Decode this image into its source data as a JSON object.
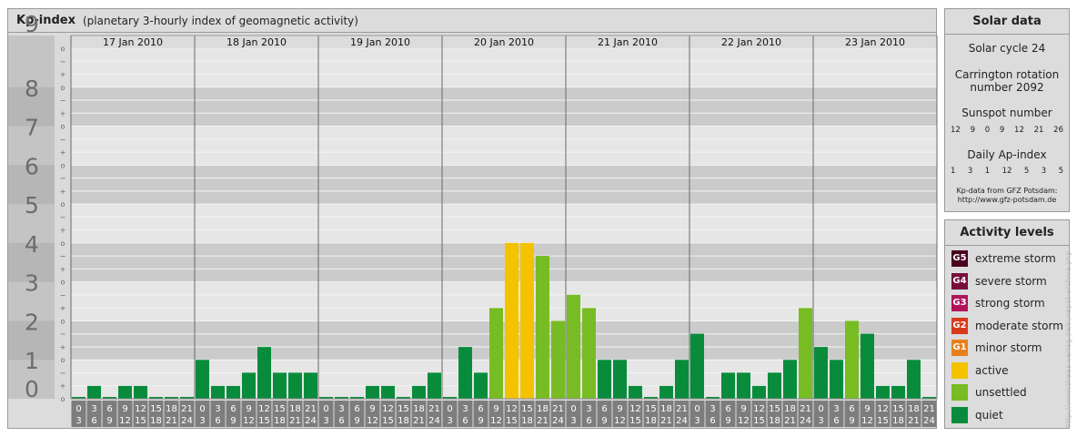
{
  "header": {
    "title": "Kp-index",
    "subtitle": "(planetary 3-hourly index of geomagnetic activity)"
  },
  "chart_data": {
    "type": "bar",
    "title": "Kp-index",
    "subtitle": "(planetary 3-hourly index of geomagnetic activity)",
    "ylim": [
      0,
      9
    ],
    "y_major_ticks": [
      "0",
      "1",
      "2",
      "3",
      "4",
      "5",
      "6",
      "7",
      "8",
      "9"
    ],
    "y_minor_ticks": [
      "o",
      "+",
      "−"
    ],
    "days": [
      "17 Jan 2010",
      "18 Jan 2010",
      "19 Jan 2010",
      "20 Jan 2010",
      "21 Jan 2010",
      "22 Jan 2010",
      "23 Jan 2010"
    ],
    "interval_start": [
      "0",
      "3",
      "6",
      "9",
      "12",
      "15",
      "18",
      "21"
    ],
    "interval_end": [
      "3",
      "6",
      "9",
      "12",
      "15",
      "18",
      "21",
      "24"
    ],
    "values": [
      [
        0,
        0.33,
        0,
        0.33,
        0.33,
        0,
        0,
        0
      ],
      [
        1.0,
        0.33,
        0.33,
        0.67,
        1.33,
        0.67,
        0.67,
        0.67
      ],
      [
        0,
        0,
        0,
        0.33,
        0.33,
        0,
        0.33,
        0.67
      ],
      [
        0,
        1.33,
        0.67,
        2.33,
        4.0,
        4.0,
        3.67,
        2.0
      ],
      [
        2.67,
        2.33,
        1.0,
        1.0,
        0.33,
        0,
        0.33,
        1.0
      ],
      [
        1.67,
        0,
        0.67,
        0.67,
        0.33,
        0.67,
        1.0,
        2.33
      ],
      [
        1.33,
        1.0,
        2.0,
        1.67,
        0.33,
        0.33,
        1.0,
        0
      ]
    ],
    "colors": {
      "quiet": "#088c3c",
      "unsettled": "#78bc23",
      "active": "#f5c200"
    },
    "grid": true
  },
  "solar": {
    "title": "Solar data",
    "cycle": "Solar cycle 24",
    "carrington_line1": "Carrington rotation",
    "carrington_line2": "number 2092",
    "sunspot_label": "Sunspot number",
    "sunspot_values": [
      "12",
      "9",
      "0",
      "9",
      "12",
      "21",
      "26"
    ],
    "ap_label": "Daily Ap-index",
    "ap_values": [
      "1",
      "3",
      "1",
      "12",
      "5",
      "3",
      "5"
    ],
    "credit_line1": "Kp-data from GFZ Potsdam:",
    "credit_line2": "http://www.gfz-potsdam.de"
  },
  "activity": {
    "title": "Activity levels",
    "levels": [
      {
        "badge": "G5",
        "label": "extreme storm",
        "color": "#4a0021"
      },
      {
        "badge": "G4",
        "label": "severe storm",
        "color": "#760f3c"
      },
      {
        "badge": "G3",
        "label": "strong storm",
        "color": "#b0155a"
      },
      {
        "badge": "G2",
        "label": "moderate storm",
        "color": "#d83a1a"
      },
      {
        "badge": "G1",
        "label": "minor storm",
        "color": "#e8801a"
      },
      {
        "badge": "",
        "label": "active",
        "color": "#f5c200"
      },
      {
        "badge": "",
        "label": "unsettled",
        "color": "#78bc23"
      },
      {
        "badge": "",
        "label": "quiet",
        "color": "#088c3c"
      }
    ]
  },
  "watermark": "http://www.theiss-verlag.de/sunspot-archive.php"
}
